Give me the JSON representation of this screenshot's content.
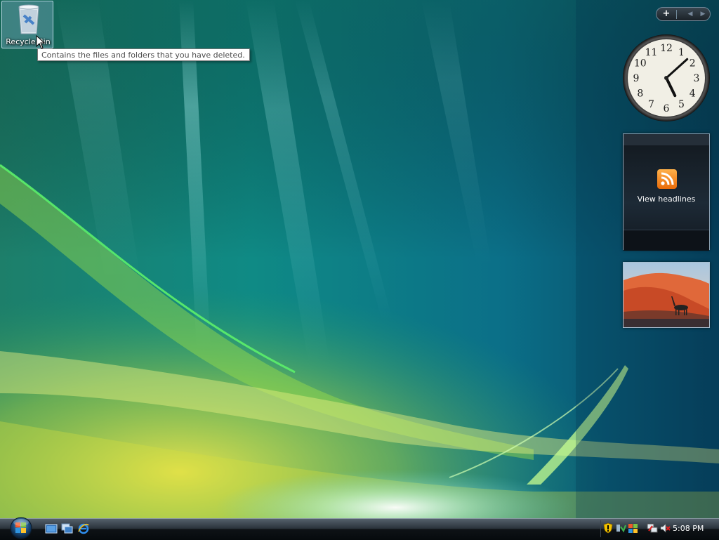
{
  "desktop": {
    "icons": [
      {
        "label": "Recycle Bin",
        "icon": "recycle-bin-icon"
      }
    ],
    "tooltip": "Contains the files and folders that you have deleted."
  },
  "sidebar": {
    "controls": {
      "add": "+",
      "prev": "◀",
      "next": "▶"
    },
    "clock": {
      "numbers": [
        "12",
        "1",
        "2",
        "3",
        "4",
        "5",
        "6",
        "7",
        "8",
        "9",
        "10",
        "11"
      ],
      "hour": 5,
      "minute": 8
    },
    "feed": {
      "label": "View headlines",
      "icon": "rss-icon"
    },
    "slideshow": {
      "icon": "slideshow-icon"
    }
  },
  "taskbar": {
    "start": {
      "icon": "windows-orb-icon"
    },
    "quick_launch": [
      "show-desktop-icon",
      "switch-windows-icon",
      "internet-explorer-icon"
    ],
    "tray_icons": [
      "security-shield-icon",
      "windows-update-icon",
      "flag-icon",
      "network-icon",
      "volume-muted-icon"
    ],
    "clock": "5:08 PM"
  },
  "colors": {
    "wallpaper_base": "#0a5a7a",
    "accent_green": "#7ae04a",
    "accent_yellow": "#e8e040",
    "rss_orange": "#f08a1a"
  }
}
